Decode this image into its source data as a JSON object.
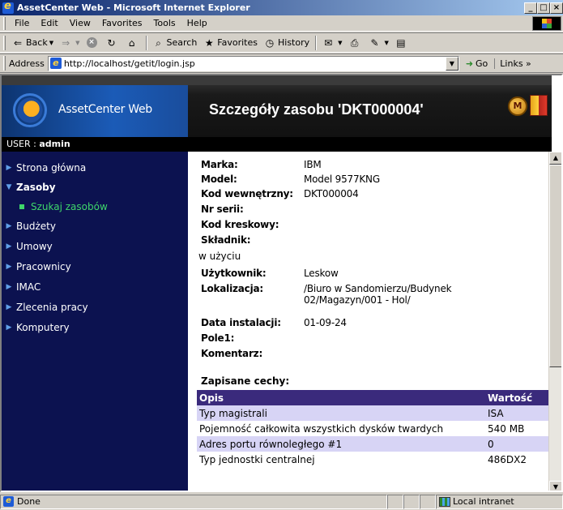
{
  "window": {
    "title": "AssetCenter Web - Microsoft Internet Explorer",
    "min_label": "_",
    "max_label": "□",
    "close_label": "×"
  },
  "menu": [
    "File",
    "Edit",
    "View",
    "Favorites",
    "Tools",
    "Help"
  ],
  "toolbar": {
    "back_label": "Back",
    "search_label": "Search",
    "favorites_label": "Favorites",
    "history_label": "History"
  },
  "address": {
    "label": "Address",
    "url": "http://localhost/getit/login.jsp",
    "go_label": "Go",
    "links_label": "Links »"
  },
  "app": {
    "name": "AssetCenter Web",
    "page_title": "Szczegóły zasobu 'DKT000004'",
    "user_prefix": "USER : ",
    "user_name": "admin"
  },
  "sidebar": {
    "items": [
      {
        "label": "Strona główna"
      },
      {
        "label": "Zasoby"
      },
      {
        "label": "Budżety"
      },
      {
        "label": "Umowy"
      },
      {
        "label": "Pracownicy"
      },
      {
        "label": "IMAC"
      },
      {
        "label": "Zlecenia pracy"
      },
      {
        "label": "Komputery"
      }
    ],
    "sub_item": "Szukaj zasobów"
  },
  "details": {
    "marka_label": "Marka:",
    "marka_value": "IBM",
    "model_label": "Model:",
    "model_value": "Model 9577KNG",
    "kod_label": "Kod wewnętrzny:",
    "kod_value": "DKT000004",
    "serial_label": "Nr serii:",
    "serial_value": "",
    "barcode_label": "Kod kreskowy:",
    "barcode_value": "",
    "component_label": "Składnik:",
    "component_value": "",
    "status": "w użyciu",
    "user_label": "Użytkownik:",
    "user_value": "Leskow",
    "location_label": "Lokalizacja:",
    "location_value_1": "/Biuro w Sandomierzu/Budynek",
    "location_value_2": "02/Magazyn/001 - Hol/",
    "install_label": "Data instalacji:",
    "install_value": "01-09-24",
    "field1_label": "Pole1:",
    "field1_value": "",
    "comment_label": "Komentarz:",
    "comment_value": ""
  },
  "features": {
    "title": "Zapisane cechy:",
    "col_desc": "Opis",
    "col_value": "Wartość",
    "rows": [
      {
        "desc": "Typ magistrali",
        "value": "ISA"
      },
      {
        "desc": "Pojemność całkowita wszystkich dysków twardych",
        "value": "540 MB"
      },
      {
        "desc": "Adres portu równoległego #1",
        "value": "0"
      },
      {
        "desc": "Typ jednostki centralnej",
        "value": "486DX2"
      }
    ]
  },
  "statusbar": {
    "status": "Done",
    "zone": "Local intranet"
  }
}
